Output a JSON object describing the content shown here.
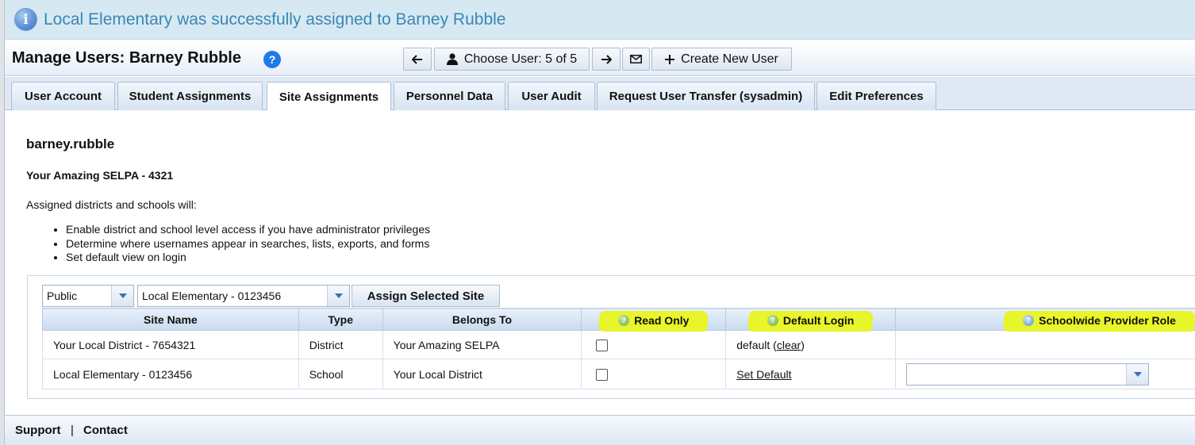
{
  "notification": {
    "text": "Local Elementary was successfully assigned to Barney Rubble",
    "icon": "info-icon"
  },
  "header": {
    "title": "Manage Users: Barney Rubble",
    "help_label": "?",
    "choose_user_label": "Choose User: 5 of 5",
    "create_new_label": "Create New User"
  },
  "tabs": [
    {
      "label": "User Account"
    },
    {
      "label": "Student Assignments"
    },
    {
      "label": "Site Assignments",
      "active": true
    },
    {
      "label": "Personnel Data"
    },
    {
      "label": "User Audit"
    },
    {
      "label": "Request User Transfer (sysadmin)"
    },
    {
      "label": "Edit Preferences"
    }
  ],
  "content": {
    "username": "barney.rubble",
    "selpa": "Your Amazing SELPA - 4321",
    "intro": "Assigned districts and schools will:",
    "bullets": [
      "Enable district and school level access if you have administrator privileges",
      "Determine where usernames appear in searches, lists, exports, and forms",
      "Set default view on login"
    ]
  },
  "assign": {
    "type_value": "Public",
    "site_value": "Local Elementary - 0123456",
    "button_label": "Assign Selected Site"
  },
  "table": {
    "headers": [
      "Site Name",
      "Type",
      "Belongs To",
      "Read Only",
      "Default Login",
      "Schoolwide Provider Role"
    ],
    "rows": [
      {
        "site": "Your Local District - 7654321",
        "type": "District",
        "belongs": "Your Amazing SELPA",
        "read_only": false,
        "default_text": "default (",
        "default_link": "clear",
        "default_close": ")"
      },
      {
        "site": "Local Elementary - 0123456",
        "type": "School",
        "belongs": "Your Local District",
        "read_only": false,
        "default_link": "Set Default",
        "role_value": ""
      }
    ]
  },
  "footer": {
    "support": "Support",
    "separator": "|",
    "contact": "Contact"
  },
  "colors": {
    "notice_text": "#3a87b5",
    "notice_bg": "#d6e9f2",
    "highlight": "#e7f52a",
    "help_blue": "#1f7ae6"
  }
}
